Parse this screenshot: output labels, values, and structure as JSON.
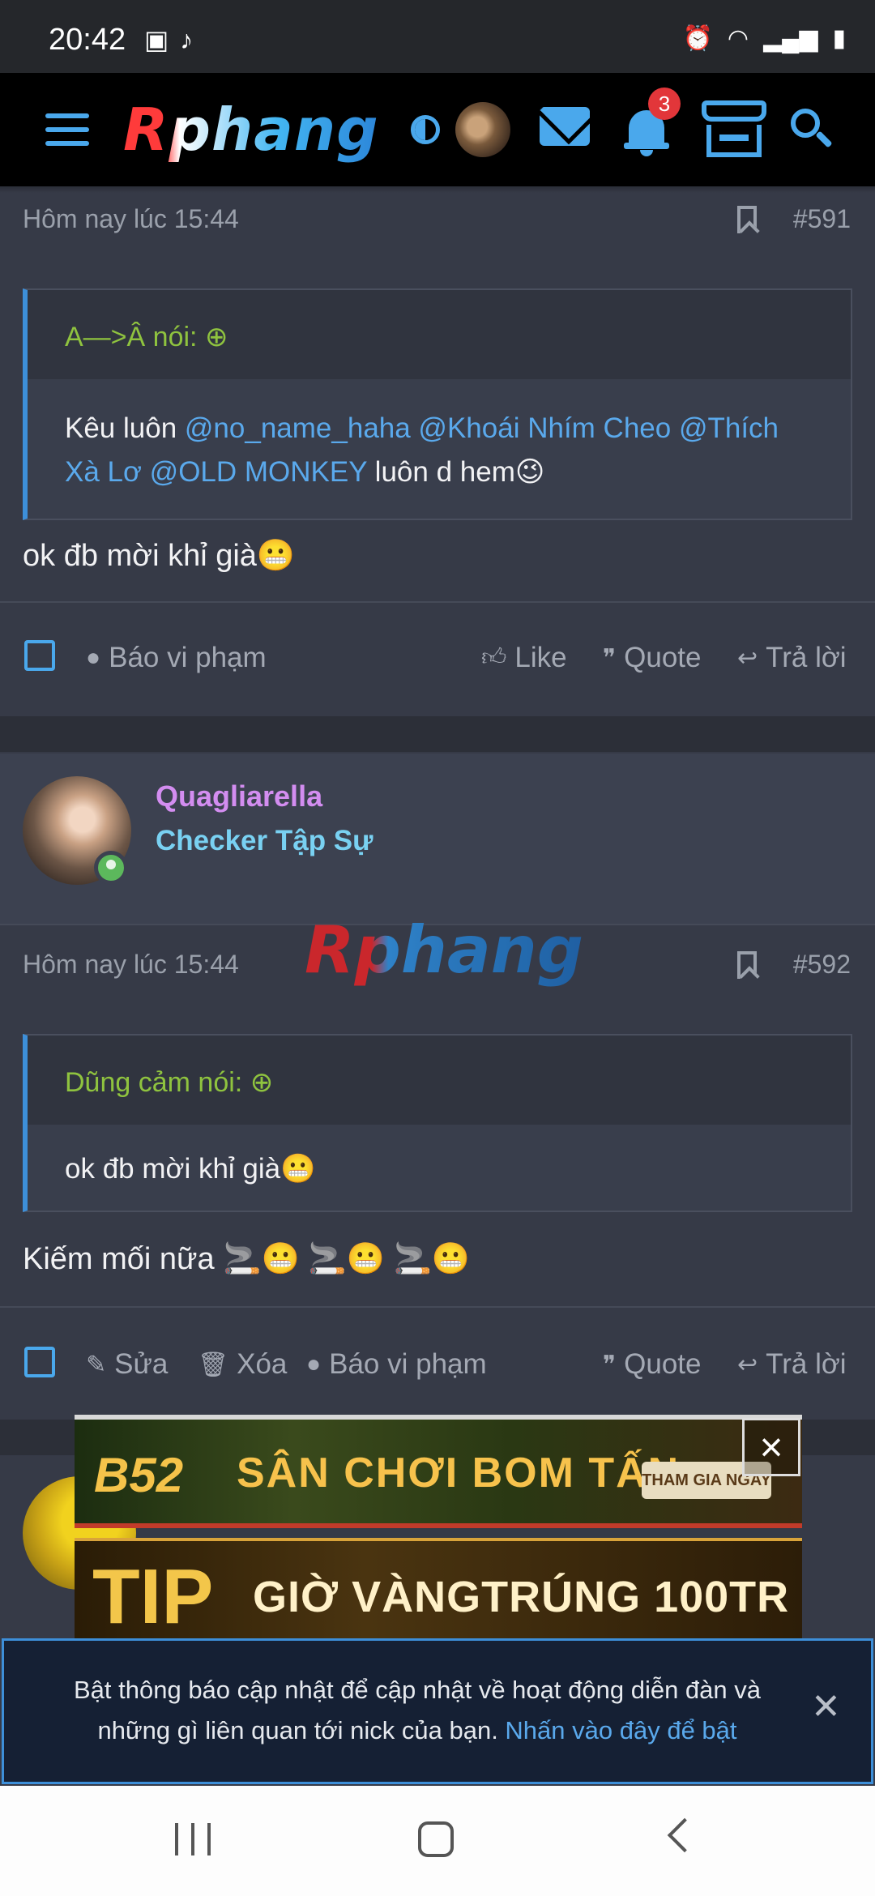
{
  "status_bar": {
    "time": "20:42"
  },
  "header": {
    "logo": "Rphang",
    "notification_count": "3"
  },
  "post591": {
    "date": "Hôm nay lúc 15:44",
    "number": "#591",
    "quote": {
      "author": "A—>Â nói:",
      "text_prefix": "Kêu luôn ",
      "mentions_line1": "@no_name_haha @Khoái Nhím Cheo @Thích",
      "mentions_line2": "Xà Lơ @OLD MONKEY",
      "text_suffix": " luôn d hem😉"
    },
    "body": "ok đb mời khỉ già😬",
    "actions": {
      "report": "Báo vi phạm",
      "like": "Like",
      "quote": "Quote",
      "reply": "Trả lời"
    }
  },
  "user": {
    "name": "Quagliarella",
    "title": "Checker Tập Sự"
  },
  "watermark": "Rphang",
  "post592": {
    "date": "Hôm nay lúc 15:44",
    "number": "#592",
    "quote": {
      "author": "Dũng cảm nói:",
      "text": "ok đb mời khỉ già😬"
    },
    "body": "Kiếm mối nữa 🚬😬 🚬😬 🚬😬",
    "actions": {
      "edit": "Sửa",
      "delete": "Xóa",
      "report": "Báo vi phạm",
      "quote": "Quote",
      "reply": "Trả lời"
    }
  },
  "ads": {
    "ad1_brand": "B52",
    "ad1_text": "SÂN CHƠI BOM TẤN",
    "ad1_cta": "THAM GIA NGAY",
    "ad2_brand": "TIP",
    "ad2_text": "GIỜ VÀNGTRÚNG 100TR"
  },
  "notification": {
    "message": "Bật thông báo cập nhật để cập nhật về hoạt động diễn đàn và những gì liên quan tới nick của bạn. ",
    "link": "Nhấn vào đây để bật"
  }
}
